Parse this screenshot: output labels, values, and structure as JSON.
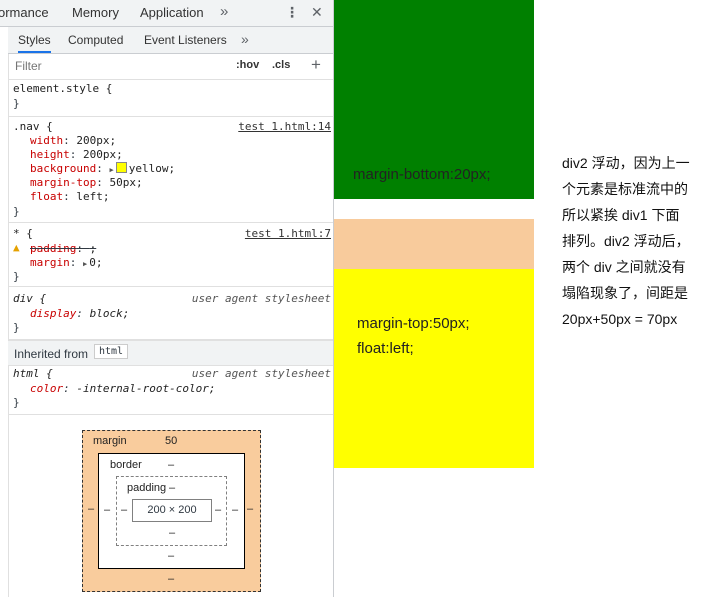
{
  "devtools": {
    "top_tabs": [
      "ormance",
      "Memory",
      "Application"
    ],
    "more_icon": "»",
    "kebab_icon": "⋮",
    "close_icon": "✕",
    "sub_tabs": [
      "Styles",
      "Computed",
      "Event Listeners"
    ],
    "sub_more_icon": "»",
    "filter": {
      "placeholder": "Filter",
      "hov": ":hov",
      "cls": ".cls",
      "add": "+"
    },
    "rules": {
      "element_style": {
        "selector": "element.style {",
        "close": "}"
      },
      "nav": {
        "selector": ".nav {",
        "source": "test 1.html:14",
        "declarations": [
          {
            "prop": "width",
            "value": "200px;"
          },
          {
            "prop": "height",
            "value": "200px;"
          },
          {
            "prop": "background",
            "value": "yellow;"
          },
          {
            "prop": "margin-top",
            "value": "50px;"
          },
          {
            "prop": "float",
            "value": "left;"
          }
        ],
        "close": "}"
      },
      "star": {
        "selector": "* {",
        "source": "test 1.html:7",
        "padding": {
          "prop": "padding",
          "value": ";"
        },
        "margin": {
          "prop": "margin",
          "value": "0;"
        },
        "close": "}"
      },
      "div_ua": {
        "selector": "div {",
        "source": "user agent stylesheet",
        "prop": "display",
        "value": "block;",
        "close": "}"
      },
      "inherited": {
        "label": "Inherited from",
        "tag": "html"
      },
      "html_ua": {
        "selector": "html {",
        "source": "user agent stylesheet",
        "prop": "color",
        "value": "-internal-root-color;",
        "close": "}"
      }
    },
    "box_model": {
      "margin_label": "margin",
      "margin_top": "50",
      "margin_side": "–",
      "margin_bottom": "–",
      "border_label": "border",
      "border_top": "–",
      "border_side": "–",
      "border_bottom": "–",
      "padding_label": "padding",
      "padding_top": "–",
      "padding_side": "–",
      "padding_bottom": "–",
      "content": "200 × 200"
    }
  },
  "preview": {
    "green_text": "margin-bottom:20px;",
    "yellow_line1": "margin-top:50px;",
    "yellow_line2": "float:left;",
    "colors": {
      "green": "#008000",
      "peach": "#f8cb9c",
      "yellow": "#ffff00"
    }
  },
  "note": [
    "div2 浮动，因为上一",
    "个元素是标准流中的",
    "所以紧挨 div1 下面",
    "排列。div2 浮动后，",
    "两个 div 之间就没有",
    "塌陷现象了，间距是",
    "20px+50px = 70px"
  ]
}
